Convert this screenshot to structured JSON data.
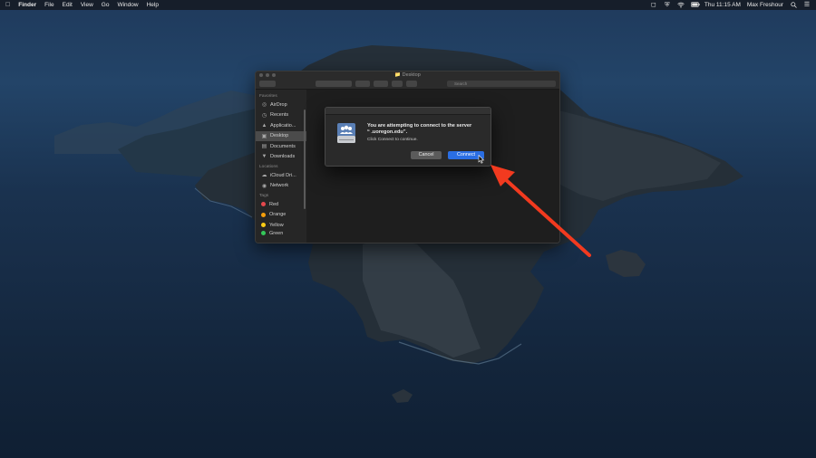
{
  "menubar": {
    "app_name": "Finder",
    "menus": [
      "File",
      "Edit",
      "View",
      "Go",
      "Window",
      "Help"
    ],
    "clock": "Thu 11:15 AM",
    "user": "Max Freshour"
  },
  "finder": {
    "window_title": "Desktop",
    "search_placeholder": "Search",
    "sidebar": {
      "favorites_label": "Favorites",
      "favorites": [
        "AirDrop",
        "Recents",
        "Applicatio...",
        "Desktop",
        "Documents",
        "Downloads"
      ],
      "locations_label": "Locations",
      "locations": [
        "iCloud Dri...",
        "Network"
      ],
      "tags_label": "Tags",
      "tags": [
        {
          "label": "Red",
          "color": "#e5484d"
        },
        {
          "label": "Orange",
          "color": "#f59e0b"
        },
        {
          "label": "Yellow",
          "color": "#facc15"
        },
        {
          "label": "Green",
          "color": "#34c759"
        }
      ]
    }
  },
  "dialog": {
    "title_line1": "You are attempting to connect to the server",
    "title_line2": "“          .uoregon.edu”.",
    "subtitle": "Click Connect to continue.",
    "cancel_label": "Cancel",
    "connect_label": "Connect"
  },
  "colors": {
    "connect_button": "#2a6ee3",
    "annotation_arrow": "#f23a1f"
  }
}
